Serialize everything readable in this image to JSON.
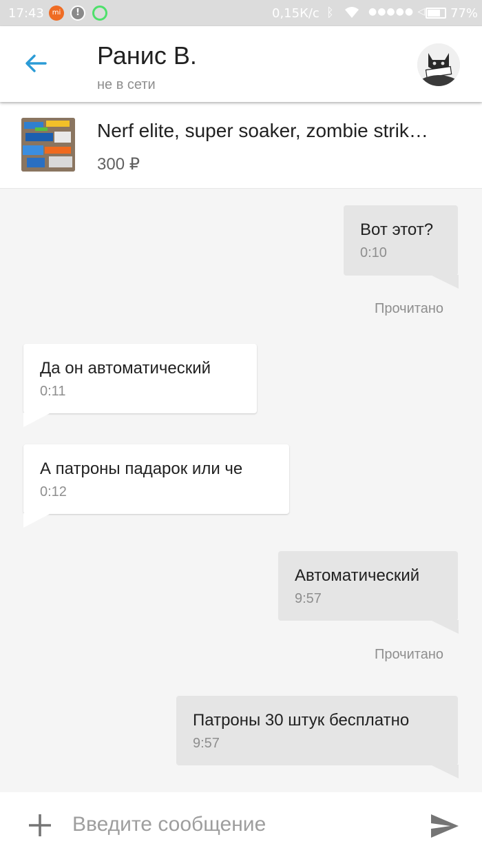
{
  "status_bar": {
    "time": "17:43",
    "network_speed": "0,15К/с",
    "battery": "77%",
    "battery_level": 0.77,
    "icons": [
      "mi-icon",
      "alert-icon",
      "message-bubble-icon",
      "bluetooth-icon",
      "wifi-icon",
      "signal-icon",
      "battery-icon"
    ]
  },
  "header": {
    "contact_name": "Ранис В.",
    "contact_status": "не в сети",
    "accent_color": "#2b9bd6"
  },
  "listing": {
    "title": "Nerf elite, super soaker, zombie strik…",
    "price": "300 ₽"
  },
  "messages": [
    {
      "direction": "outgoing",
      "text": "Вот этот?",
      "time": "0:10"
    },
    {
      "direction": "incoming",
      "text": "Да он автоматический",
      "time": "0:11"
    },
    {
      "direction": "incoming",
      "text": "А патроны падарок или че",
      "time": "0:12"
    },
    {
      "direction": "outgoing",
      "text": "Автоматический",
      "time": "9:57"
    },
    {
      "direction": "outgoing",
      "text": "Патроны 30 штук бесплатно",
      "time": "9:57"
    }
  ],
  "read_receipts": [
    "Прочитано",
    "Прочитано"
  ],
  "composer": {
    "placeholder": "Введите сообщение"
  }
}
